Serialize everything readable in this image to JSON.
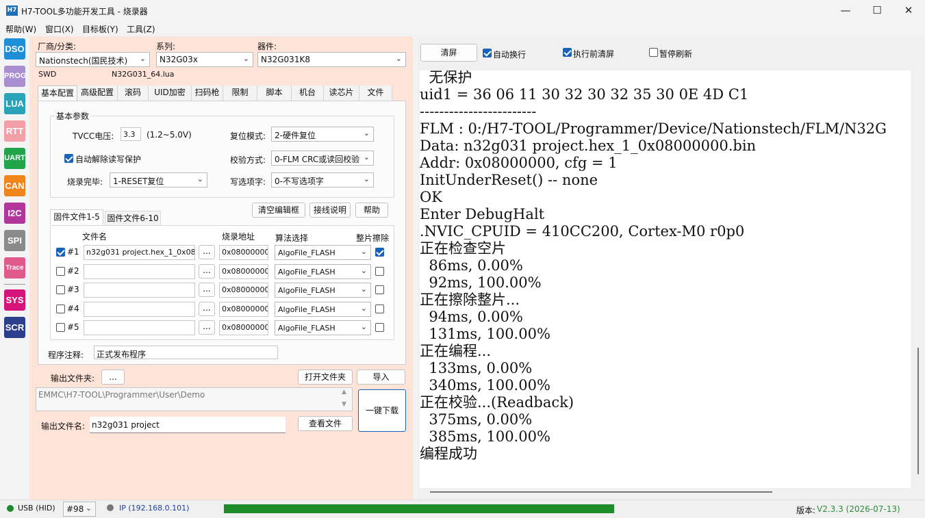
{
  "window": {
    "title": "H7-TOOL多功能开发工具 - 烧录器",
    "icon_text": "H7"
  },
  "menu": [
    "帮助(W)",
    "窗口(X)",
    "目标板(Y)",
    "工具(Z)"
  ],
  "toolbar": [
    {
      "label": "DSO",
      "color": "#1e8fd6"
    },
    {
      "label": "PROG",
      "color": "#a98fd0"
    },
    {
      "label": "LUA",
      "color": "#2aa3b8"
    },
    {
      "label": "RTT",
      "color": "#f2a0a8"
    },
    {
      "label": "UART",
      "color": "#21a44a"
    },
    {
      "label": "CAN",
      "color": "#f0861b"
    },
    {
      "label": "I2C",
      "color": "#b0369c"
    },
    {
      "label": "SPI",
      "color": "#8a8a8a"
    },
    {
      "label": "Trace",
      "color": "#e05a8a"
    },
    {
      "label": "SYS",
      "color": "#d4147a"
    },
    {
      "label": "SCR",
      "color": "#2c3f8f"
    }
  ],
  "selectors": {
    "vendor_label": "厂商/分类:",
    "vendor_value": "Nationstech(国民技术)",
    "series_label": "系列:",
    "series_value": "N32G03x",
    "device_label": "器件:",
    "device_value": "N32G031K8",
    "interface": "SWD",
    "lua_file": "N32G031_64.lua"
  },
  "tabs": [
    "基本配置",
    "高级配置",
    "滚码",
    "UID加密",
    "扫码枪",
    "限制",
    "脚本",
    "机台",
    "读芯片",
    "文件"
  ],
  "basic": {
    "group_title": "基本参数",
    "tvcc_label": "TVCC电压:",
    "tvcc_value": "3.3",
    "tvcc_range": "(1.2~5.0V)",
    "auto_unprotect_label": "自动解除读写保护",
    "auto_unprotect_checked": true,
    "done_label": "烧录完毕:",
    "done_value": "1-RESET复位",
    "reset_label": "复位模式:",
    "reset_value": "2-硬件复位",
    "verify_label": "校验方式:",
    "verify_value": "0-FLM CRC或读回校验",
    "option_label": "写选项字:",
    "option_value": "0-不写选项字",
    "btn_clear": "清空编辑框",
    "btn_wiring": "接线说明",
    "btn_help": "帮助"
  },
  "firmware": {
    "subtabs": [
      "固件文件1-5",
      "固件文件6-10"
    ],
    "col_name": "文件名",
    "col_addr": "烧录地址",
    "col_algo": "算法选择",
    "col_erase": "整片擦除",
    "browse": "...",
    "rows": [
      {
        "id": "#1",
        "checked": true,
        "file": "n32g031 project.hex_1_0x08000000.bin",
        "addr": "0x08000000",
        "algo": "AlgoFile_FLASH",
        "erase": true
      },
      {
        "id": "#2",
        "checked": false,
        "file": "",
        "addr": "0x08000000",
        "algo": "AlgoFile_FLASH",
        "erase": false
      },
      {
        "id": "#3",
        "checked": false,
        "file": "",
        "addr": "0x08000000",
        "algo": "AlgoFile_FLASH",
        "erase": false
      },
      {
        "id": "#4",
        "checked": false,
        "file": "",
        "addr": "0x08000000",
        "algo": "AlgoFile_FLASH",
        "erase": false
      },
      {
        "id": "#5",
        "checked": false,
        "file": "",
        "addr": "0x08000000",
        "algo": "AlgoFile_FLASH",
        "erase": false
      }
    ],
    "note_label": "程序注释:",
    "note_value": "正式发布程序"
  },
  "output": {
    "folder_label": "输出文件夹:",
    "folder_btn": "...",
    "open_folder": "打开文件夹",
    "import": "导入",
    "path": "EMMC\\H7-TOOL\\Programmer\\User\\Demo",
    "download": "一键下载",
    "name_label": "输出文件名:",
    "name_value": "n32g031 project",
    "view_file": "查看文件"
  },
  "console": {
    "clear": "清屏",
    "auto_wrap": "自动换行",
    "auto_wrap_checked": true,
    "clear_before": "执行前清屏",
    "clear_before_checked": true,
    "pause": "暂停刷新",
    "pause_checked": false,
    "lines": [
      "  无保护",
      "uid1 = 36 06 11 30 32 30 32 35 30 0E 4D C1",
      "------------------------",
      "FLM : 0:/H7-TOOL/Programmer/Device/Nationstech/FLM/N32G",
      "Data: n32g031 project.hex_1_0x08000000.bin",
      "Addr: 0x08000000, cfg = 1",
      "InitUnderReset() -- none",
      "OK",
      "Enter DebugHalt",
      ".NVIC_CPUID = 410CC200, Cortex-M0 r0p0",
      "正在检查空片",
      "  86ms, 0.00%",
      "  92ms, 100.00%",
      "正在擦除整片...",
      "  94ms, 0.00%",
      "  131ms, 100.00%",
      "正在编程...",
      "  133ms, 0.00%",
      "  340ms, 100.00%",
      "正在校验...(Readback)",
      "  375ms, 0.00%",
      "  385ms, 100.00%",
      "编程成功"
    ]
  },
  "status": {
    "usb": "USB (HID)",
    "usb_color": "#1a8a2a",
    "device_no": "#98",
    "ip": "IP (192.168.0.101)",
    "ip_color": "#777777",
    "progress": 1.0,
    "version_label": "版本:",
    "version_value": "V2.3.3 (2026-07-13)"
  }
}
